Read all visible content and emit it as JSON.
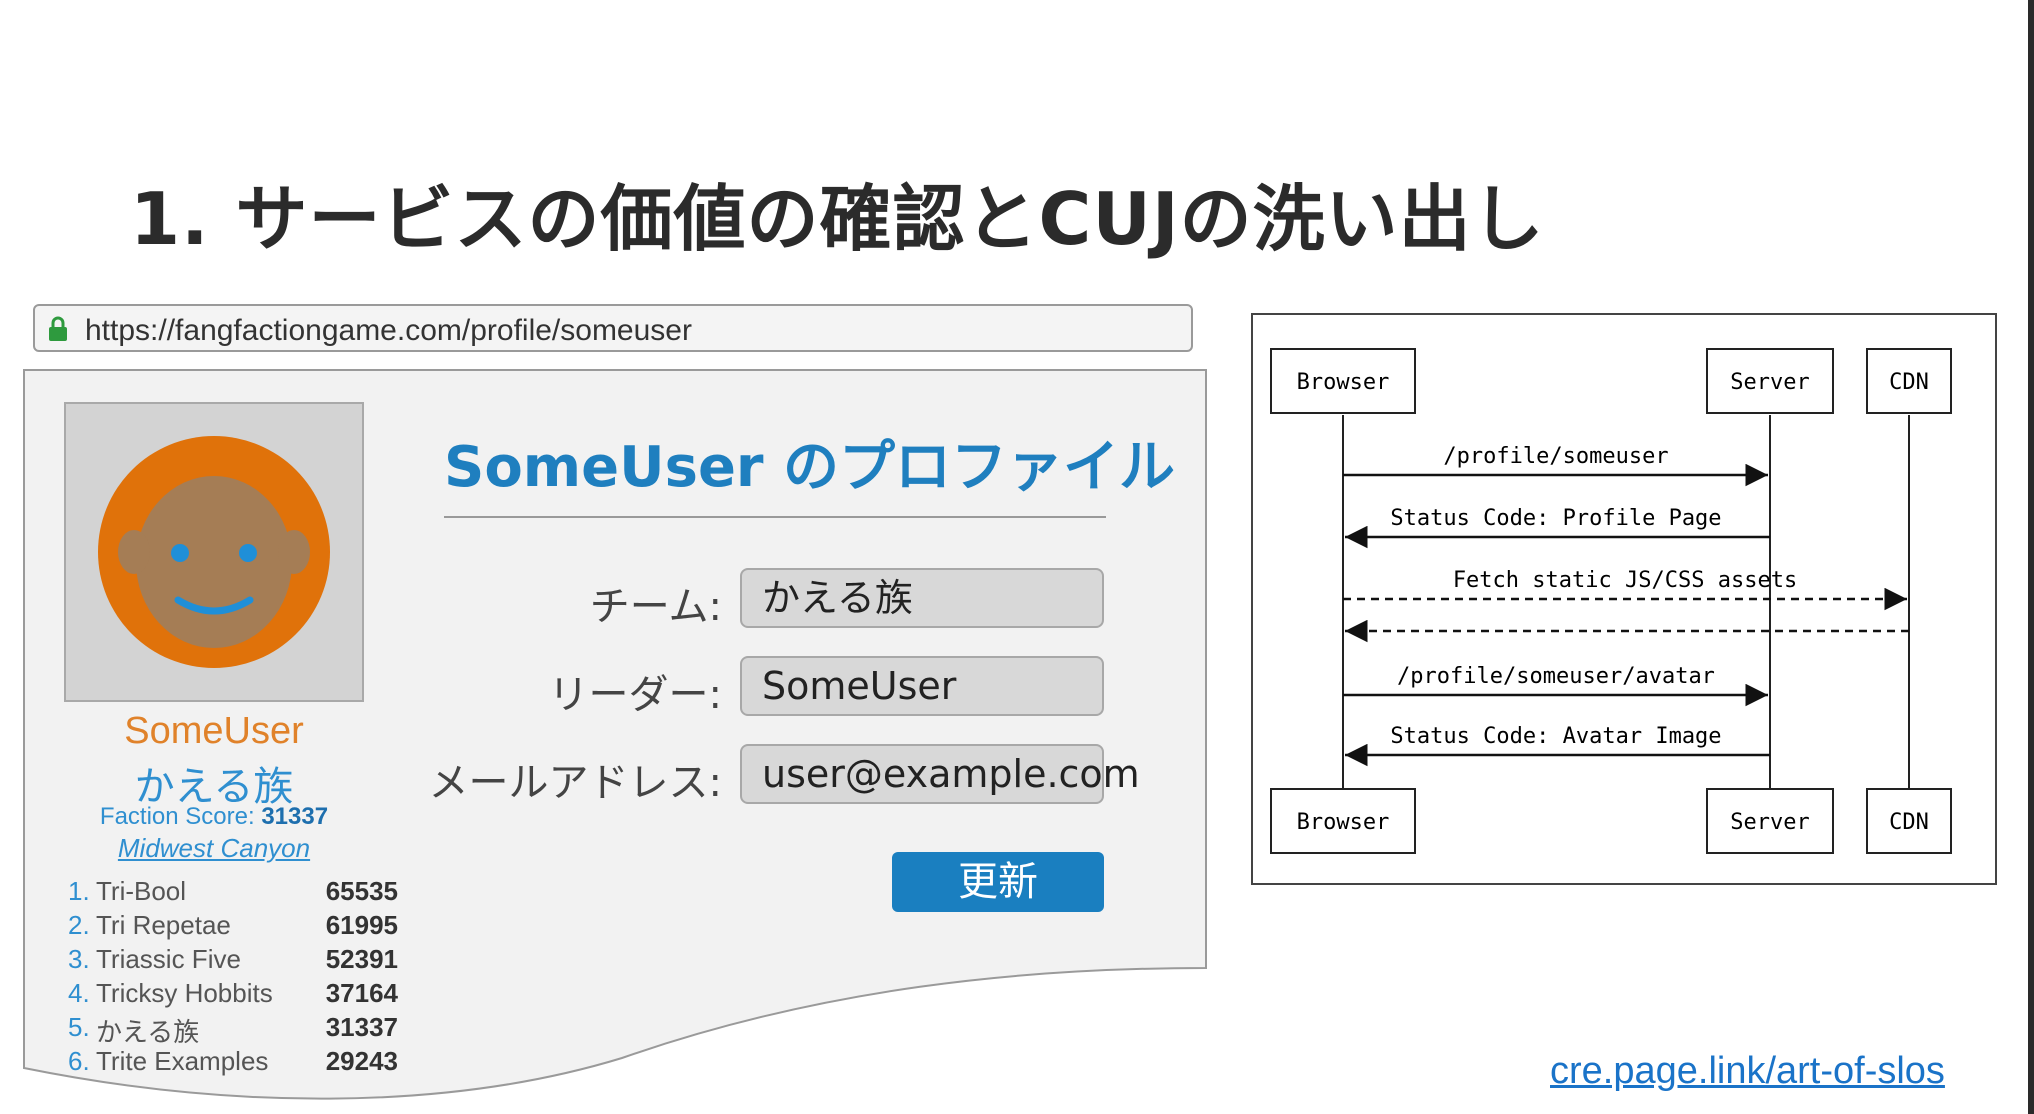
{
  "slide": {
    "title": "1. サービスの価値の確認とCUJの洗い出し",
    "footer_link": "cre.page.link/art-of-slos"
  },
  "browser": {
    "url": "https://fangfactiongame.com/profile/someuser",
    "icons": {
      "lock": "lock-icon"
    }
  },
  "profile": {
    "avatar_icon": "user-avatar-face",
    "name": "SomeUser",
    "team": "かえる族",
    "faction_score_label": "Faction Score:",
    "faction_score": "31337",
    "region": "Midwest Canyon",
    "heading": "SomeUser のプロファイル",
    "fields": [
      {
        "label": "チーム:",
        "value": "かえる族"
      },
      {
        "label": "リーダー:",
        "value": "SomeUser"
      },
      {
        "label": "メールアドレス:",
        "value": "user@example.com"
      }
    ],
    "update_button": "更新",
    "leaderboard": [
      {
        "rank": "1.",
        "name": "Tri-Bool",
        "score": "65535"
      },
      {
        "rank": "2.",
        "name": "Tri Repetae",
        "score": "61995"
      },
      {
        "rank": "3.",
        "name": "Triassic Five",
        "score": "52391"
      },
      {
        "rank": "4.",
        "name": "Tricksy Hobbits",
        "score": "37164"
      },
      {
        "rank": "5.",
        "name": "かえる族",
        "score": "31337"
      },
      {
        "rank": "6.",
        "name": "Trite Examples",
        "score": "29243"
      }
    ]
  },
  "sequence_diagram": {
    "participants": [
      "Browser",
      "Server",
      "CDN"
    ],
    "messages": [
      {
        "from": "Browser",
        "to": "Server",
        "label": "/profile/someuser",
        "style": "solid"
      },
      {
        "from": "Server",
        "to": "Browser",
        "label": "Status Code: Profile Page",
        "style": "solid"
      },
      {
        "from": "Browser",
        "to": "CDN",
        "label": "Fetch static JS/CSS assets",
        "style": "dashed"
      },
      {
        "from": "CDN",
        "to": "Browser",
        "label": "",
        "style": "dashed"
      },
      {
        "from": "Browser",
        "to": "Server",
        "label": "/profile/someuser/avatar",
        "style": "solid"
      },
      {
        "from": "Server",
        "to": "Browser",
        "label": "Status Code: Avatar Image",
        "style": "solid"
      }
    ]
  },
  "colors": {
    "accent_blue": "#1f7fbf",
    "button_blue": "#1a7fc0",
    "avatar_orange": "#e0720a",
    "avatar_face": "#a57d55",
    "name_orange": "#e0822a"
  }
}
